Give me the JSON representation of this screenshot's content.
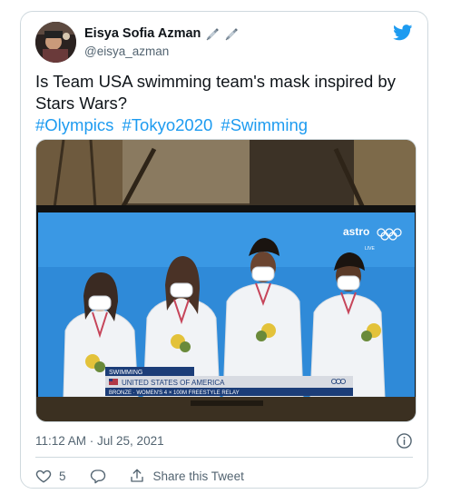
{
  "author": {
    "display_name": "Eisya Sofia Azman",
    "handle": "@eisya_azman"
  },
  "tweet": {
    "text": "Is Team USA swimming team's mask inspired by\nStars Wars?",
    "hashtags": [
      "#Olympics",
      "#Tokyo2020",
      "#Swimming"
    ],
    "timestamp": "11:12 AM · Jul 25, 2021"
  },
  "media": {
    "broadcaster": "astro",
    "broadcaster_sub": "LIVE",
    "event_label": "SWIMMING",
    "country": "UNITED STATES OF AMERICA",
    "result": "BRONZE · WOMEN'S 4 × 100M FREESTYLE RELAY"
  },
  "actions": {
    "like_count": "5",
    "share_label": "Share this Tweet"
  },
  "colors": {
    "link": "#1d9bf0",
    "muted": "#536471",
    "border": "#cfd9de"
  },
  "icons": [
    "twitter-bird-icon",
    "syringe-icon",
    "info-icon",
    "heart-icon",
    "reply-icon",
    "share-icon"
  ]
}
